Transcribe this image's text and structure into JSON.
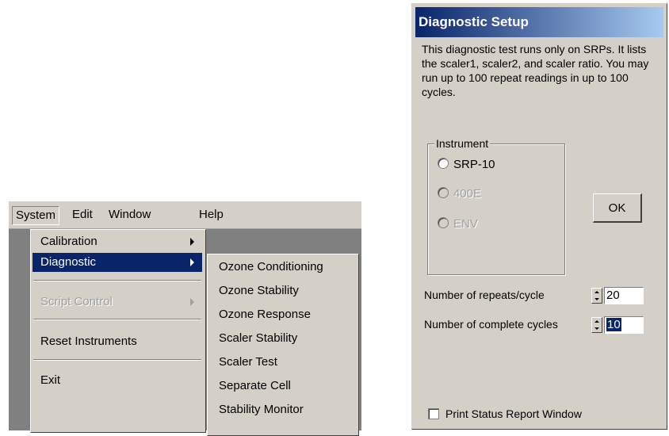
{
  "menu": {
    "menubar": [
      "System",
      "Edit",
      "Window",
      "Help"
    ],
    "system_items": {
      "calibration": "Calibration",
      "diagnostic": "Diagnostic",
      "script_control": "Script Control",
      "reset_instruments": "Reset Instruments",
      "exit": "Exit"
    },
    "diagnostic_submenu": [
      "Ozone Conditioning",
      "Ozone Stability",
      "Ozone Response",
      "Scaler Stability",
      "Scaler Test",
      "Separate Cell",
      "Stability Monitor"
    ]
  },
  "dialog": {
    "title": "Diagnostic Setup",
    "description": "This diagnostic test runs only on SRPs. It lists the scaler1, scaler2, and scaler ratio.  You may run up to 100 repeat readings in up to 100 cycles.",
    "instrument_group_label": "Instrument",
    "instruments": [
      "SRP-10",
      "400E",
      "ENV"
    ],
    "ok_label": "OK",
    "repeats_label": "Number of repeats/cycle",
    "repeats_value": "20",
    "cycles_label": "Number of complete cycles",
    "cycles_value": "10",
    "print_status_label": "Print Status Report Window"
  }
}
